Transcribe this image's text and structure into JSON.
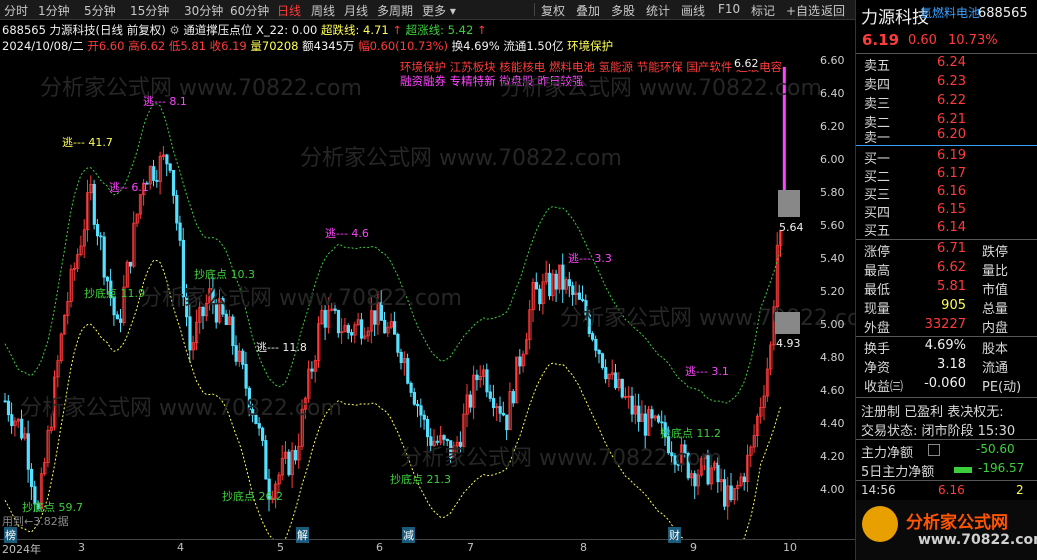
{
  "toolbar": {
    "periods": [
      "分时",
      "1分钟",
      "5分钟",
      "15分钟",
      "30分钟",
      "60分钟",
      "日线",
      "周线",
      "月线",
      "多周期",
      "更多"
    ],
    "active_period": "日线",
    "right_buttons": [
      "复权",
      "叠加",
      "多股",
      "统计",
      "画线",
      "F10",
      "标记",
      "+自选",
      "返回"
    ]
  },
  "info": {
    "title": "688565 力源科技(日线 前复权)",
    "indicator_name": "通道撑压点位",
    "x22": "X_22: 0.00",
    "fall_label": "超跌线: 4.71",
    "rise_label": "超涨线: 5.42",
    "date": "2024/10/08/二",
    "open": "开6.60",
    "high": "高6.62",
    "low": "低5.81",
    "close": "收6.19",
    "volume": "量70208",
    "amount": "额4345万",
    "change": "幅0.60(10.73%)",
    "turnover": "换4.69%",
    "float": "流通1.50亿",
    "concept_tag": "环境保护",
    "concepts_line1": "环境保护 江苏板块 核能核电 燃料电池 氢能源 节能环保 国产软件 超级电容",
    "concepts_line2": "融资融券 专精特新 微盘股 昨日较强"
  },
  "chart_data": {
    "type": "candlestick",
    "x_tick_labels": [
      "2024年",
      "3",
      "4",
      "5",
      "6",
      "7",
      "8",
      "9",
      "10"
    ],
    "y_ticks": [
      "6.60",
      "6.40",
      "6.20",
      "6.00",
      "5.80",
      "5.60",
      "5.40",
      "5.20",
      "5.00",
      "4.80",
      "4.60",
      "4.40",
      "4.20",
      "4.00"
    ],
    "ylim": [
      3.9,
      6.7
    ],
    "last_price_marker": "5.64",
    "lower_marker": "4.93",
    "high_marker": "6.62",
    "bottom_note": "用到←3.82据",
    "bottom_tags": [
      "榜",
      "解",
      "减",
      "财"
    ],
    "annotations": [
      {
        "text": "逃---  41.7",
        "kind": "escape"
      },
      {
        "text": "逃---  8.1",
        "kind": "escape"
      },
      {
        "text": "逃--  6.1",
        "kind": "escape"
      },
      {
        "text": "逃---  4.6",
        "kind": "escape"
      },
      {
        "text": "逃---  11.8",
        "kind": "escape"
      },
      {
        "text": "逃---  3.3",
        "kind": "escape"
      },
      {
        "text": "逃---  3.1",
        "kind": "escape"
      },
      {
        "text": "抄底点  59.7",
        "kind": "bottom"
      },
      {
        "text": "抄底点  11.9",
        "kind": "bottom"
      },
      {
        "text": "抄底点  10.3",
        "kind": "bottom"
      },
      {
        "text": "抄底点  26.2",
        "kind": "bottom"
      },
      {
        "text": "抄底点  21.3",
        "kind": "bottom"
      },
      {
        "text": "抄底点  11.2",
        "kind": "bottom"
      }
    ]
  },
  "watermarks": [
    "分析家公式网 www.70822.com"
  ],
  "panel": {
    "name": "力源科技",
    "sector": "氢燃料电池",
    "code": "688565",
    "price": "6.19",
    "chg": "0.60",
    "pct": "10.73%",
    "asks": [
      {
        "label": "卖五",
        "price": "6.24"
      },
      {
        "label": "卖四",
        "price": "6.23"
      },
      {
        "label": "卖三",
        "price": "6.22"
      },
      {
        "label": "卖二",
        "price": "6.21"
      },
      {
        "label": "卖一",
        "price": "6.20"
      }
    ],
    "bids": [
      {
        "label": "买一",
        "price": "6.19"
      },
      {
        "label": "买二",
        "price": "6.17"
      },
      {
        "label": "买三",
        "price": "6.16"
      },
      {
        "label": "买四",
        "price": "6.15"
      },
      {
        "label": "买五",
        "price": "6.14"
      }
    ],
    "stats": [
      {
        "l1": "涨停",
        "v1": "6.71",
        "l2": "跌停"
      },
      {
        "l1": "最高",
        "v1": "6.62",
        "l2": "量比"
      },
      {
        "l1": "最低",
        "v1": "5.81",
        "l2": "市值"
      },
      {
        "l1": "现量",
        "v1": "905",
        "l2": "总量"
      },
      {
        "l1": "外盘",
        "v1": "33227",
        "l2": "内盘"
      }
    ],
    "stats2": [
      {
        "l1": "换手",
        "v1": "4.69%",
        "l2": "股本"
      },
      {
        "l1": "净资",
        "v1": "3.18",
        "l2": "流通"
      },
      {
        "l1": "收益㈢",
        "v1": "-0.060",
        "l2": "PE(动)"
      }
    ],
    "reg_line": "注册制 已盈利 表决权无:",
    "status_line": "交易状态: 闭市阶段 15:30",
    "main_flow_label": "主力净额",
    "main_flow_value": "-50.60",
    "flow5_label": "5日主力净额",
    "flow5_value": "-196.57",
    "tick_time": "14:56",
    "tick_price": "6.16",
    "tick_vol": "2",
    "logo_text": "分析家公式网",
    "logo_url": "www.70822.com"
  }
}
